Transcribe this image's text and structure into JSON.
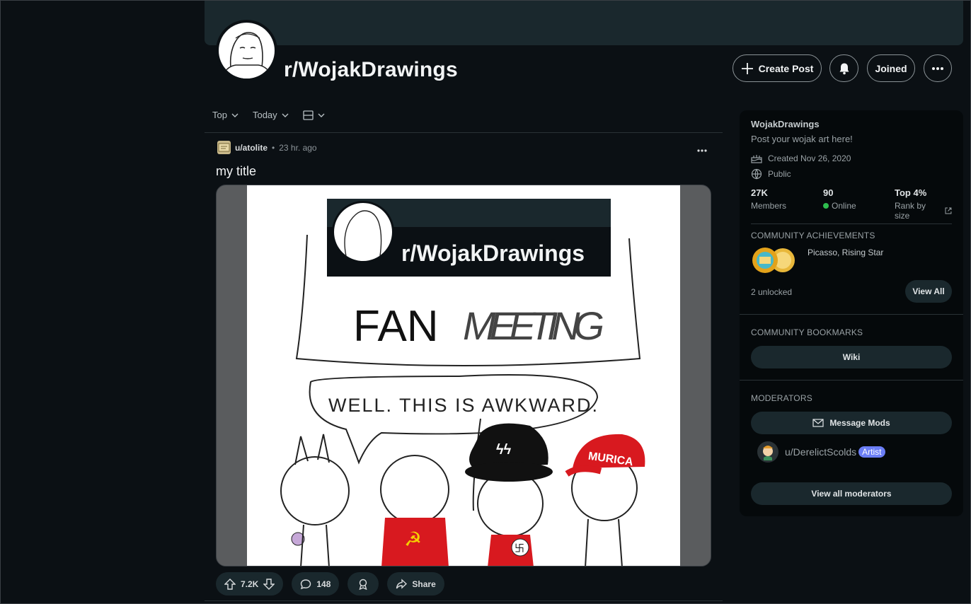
{
  "subreddit": {
    "name": "r/WojakDrawings",
    "buttons": {
      "create_post": "Create Post",
      "joined": "Joined"
    }
  },
  "feed": {
    "sort": "Top",
    "time": "Today",
    "view_icon": "card-view-icon"
  },
  "post": {
    "author": "u/atolite",
    "time": "23 hr. ago",
    "separator": "•",
    "title": "my title",
    "image_text": {
      "sub_name": "r/WojakDrawings",
      "fan": "FAN",
      "meeting": "MEETING",
      "bubble": "WELL. THIS IS AWKWARD.",
      "hat_text": "MURICA"
    },
    "votes": "7.2K",
    "comments": "148",
    "share": "Share"
  },
  "sidebar": {
    "title": "WojakDrawings",
    "description": "Post your wojak art here!",
    "created": "Created Nov 26, 2020",
    "visibility": "Public",
    "stats": [
      {
        "value": "27K",
        "label": "Members"
      },
      {
        "value": "90",
        "label": "Online"
      },
      {
        "value": "Top 4%",
        "label": "Rank by size"
      }
    ],
    "achievements": {
      "heading": "COMMUNITY ACHIEVEMENTS",
      "names": "Picasso, Rising Star",
      "unlocked": "2 unlocked",
      "view_all": "View All"
    },
    "bookmarks": {
      "heading": "COMMUNITY BOOKMARKS",
      "wiki": "Wiki"
    },
    "moderators": {
      "heading": "MODERATORS",
      "message": "Message Mods",
      "mod_name": "u/DerelictScolds",
      "mod_flair": "Artist",
      "view_all": "View all moderators"
    }
  },
  "colors": {
    "background": "#0b1014",
    "banner": "#1a282d",
    "online": "#2ebd4e",
    "flair": "#6b7ef6",
    "red": "#d8191f"
  }
}
